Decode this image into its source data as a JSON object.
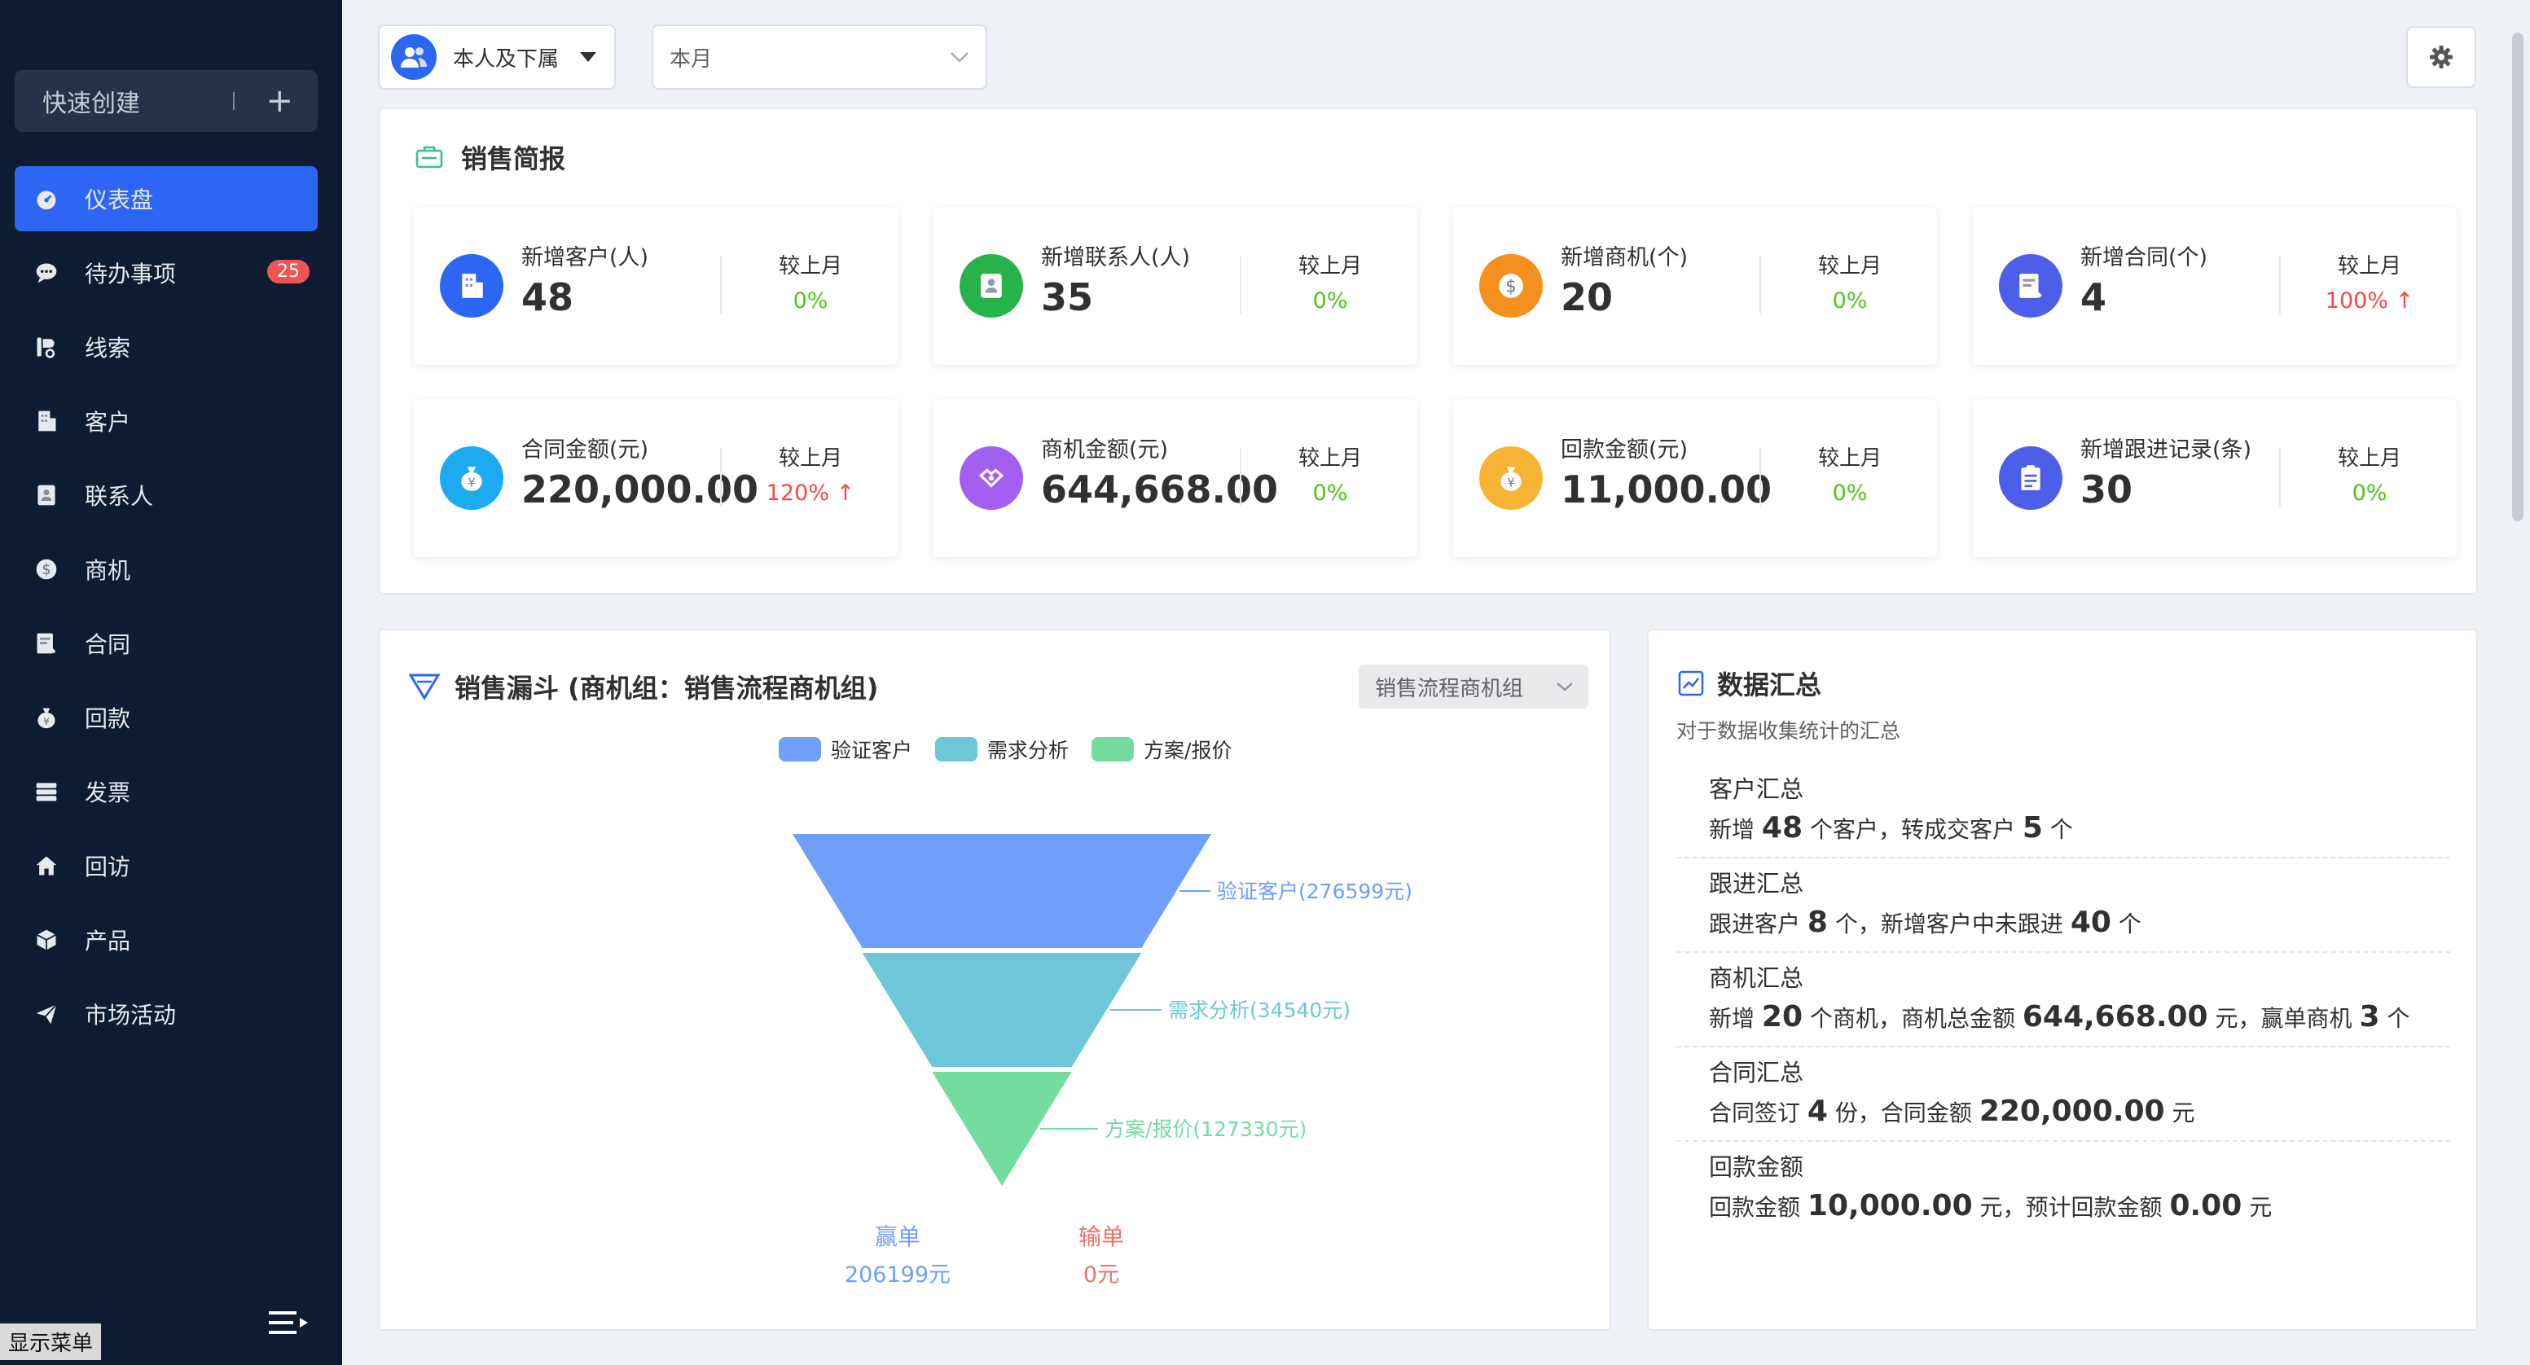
{
  "sidebar": {
    "quick_create": "快速创建",
    "items": [
      {
        "label": "仪表盘",
        "icon": "dashboard-icon",
        "active": true
      },
      {
        "label": "待办事项",
        "icon": "chat-icon",
        "badge": "25"
      },
      {
        "label": "线索",
        "icon": "clue-icon"
      },
      {
        "label": "客户",
        "icon": "building-icon"
      },
      {
        "label": "联系人",
        "icon": "contact-icon"
      },
      {
        "label": "商机",
        "icon": "dollar-icon"
      },
      {
        "label": "合同",
        "icon": "contract-icon"
      },
      {
        "label": "回款",
        "icon": "moneybag-icon"
      },
      {
        "label": "发票",
        "icon": "invoice-icon"
      },
      {
        "label": "回访",
        "icon": "home-icon"
      },
      {
        "label": "产品",
        "icon": "box-icon"
      },
      {
        "label": "市场活动",
        "icon": "send-icon"
      }
    ],
    "show_menu": "显示菜单"
  },
  "topbar": {
    "scope": "本人及下属",
    "period": "本月"
  },
  "brief": {
    "title": "销售简报",
    "compare_label": "较上月",
    "cards": [
      {
        "label": "新增客户(人)",
        "value": "48",
        "change": "0%",
        "trend": "flat",
        "color": "#2d66f3",
        "icon": "building-icon"
      },
      {
        "label": "新增联系人(人)",
        "value": "35",
        "change": "0%",
        "trend": "flat",
        "color": "#27b34a",
        "icon": "contact-icon"
      },
      {
        "label": "新增商机(个)",
        "value": "20",
        "change": "0%",
        "trend": "flat",
        "color": "#f5901e",
        "icon": "dollar-icon"
      },
      {
        "label": "新增合同(个)",
        "value": "4",
        "change": "100%",
        "trend": "up",
        "color": "#4d5fe8",
        "icon": "contract-icon"
      },
      {
        "label": "合同金额(元)",
        "value": "220,000.00",
        "change": "120%",
        "trend": "up",
        "color": "#1eaaf0",
        "icon": "moneybag-icon"
      },
      {
        "label": "商机金额(元)",
        "value": "644,668.00",
        "change": "0%",
        "trend": "flat",
        "color": "#a25ff0",
        "icon": "handshake-icon"
      },
      {
        "label": "回款金额(元)",
        "value": "11,000.00",
        "change": "0%",
        "trend": "flat",
        "color": "#f7b434",
        "icon": "moneybag-icon"
      },
      {
        "label": "新增跟进记录(条)",
        "value": "30",
        "change": "0%",
        "trend": "flat",
        "color": "#4d5fe8",
        "icon": "clipboard-icon"
      }
    ]
  },
  "funnel": {
    "title": "销售漏斗 (商机组：销售流程商机组)",
    "group_select": "销售流程商机组",
    "won_label": "赢单",
    "won_value": "206199元",
    "lost_label": "输单",
    "lost_value": "0元"
  },
  "chart_data": {
    "type": "funnel",
    "categories": [
      "验证客户",
      "需求分析",
      "方案/报价"
    ],
    "values": [
      276599,
      34540,
      127330
    ],
    "labels": [
      "验证客户(276599元)",
      "需求分析(34540元)",
      "方案/报价(127330元)"
    ],
    "colors": [
      "#6f9ff8",
      "#6ec7d6",
      "#75dca0"
    ]
  },
  "summary": {
    "title": "数据汇总",
    "subtitle": "对于数据收集统计的汇总",
    "customer": {
      "title": "客户汇总",
      "t1": "新增",
      "v1": "48",
      "t2": "个客户，转成交客户",
      "v2": "5",
      "t3": "个"
    },
    "followup": {
      "title": "跟进汇总",
      "t1": "跟进客户",
      "v1": "8",
      "t2": "个，新增客户中未跟进",
      "v2": "40",
      "t3": "个"
    },
    "opportunity": {
      "title": "商机汇总",
      "t1": "新增",
      "v1": "20",
      "t2": "个商机，商机总金额",
      "v2": "644,668.00",
      "t3": "元，赢单商机",
      "v3": "3",
      "t4": "个"
    },
    "contract": {
      "title": "合同汇总",
      "t1": "合同签订",
      "v1": "4",
      "t2": "份，合同金额",
      "v2": "220,000.00",
      "t3": "元"
    },
    "payment": {
      "title": "回款金额",
      "t1": "回款金额",
      "v1": "10,000.00",
      "t2": "元，预计回款金额",
      "v2": "0.00",
      "t3": "元"
    }
  }
}
